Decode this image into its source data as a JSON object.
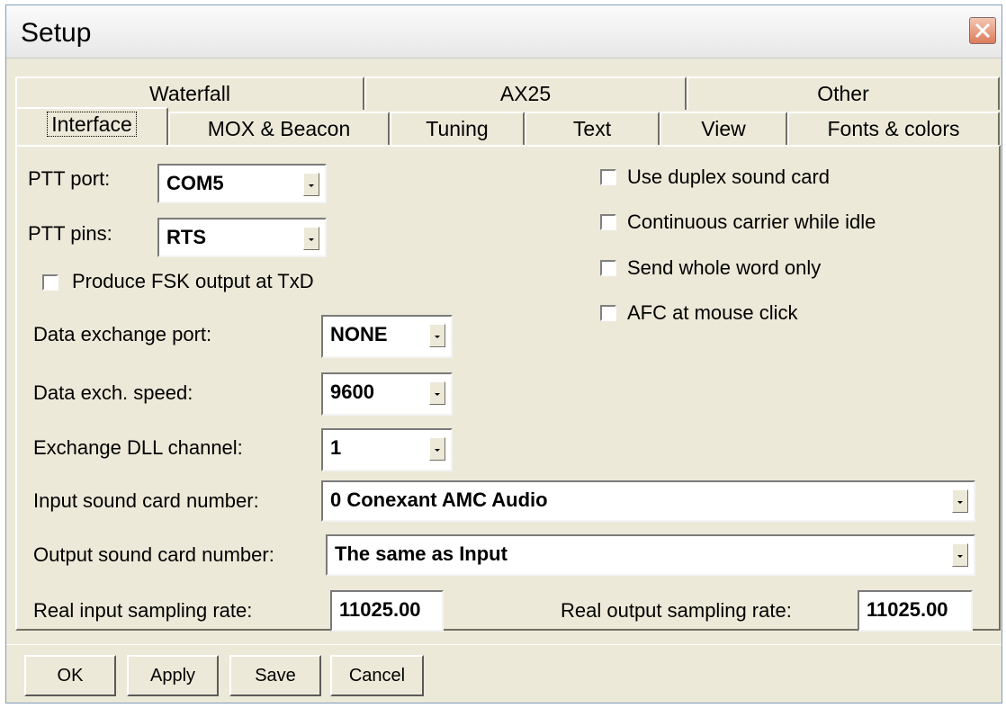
{
  "window": {
    "title": "Setup"
  },
  "tabs_row1": [
    {
      "label": "Waterfall"
    },
    {
      "label": "AX25"
    },
    {
      "label": "Other"
    }
  ],
  "tabs_row2": [
    {
      "label": "Interface",
      "selected": true
    },
    {
      "label": "MOX & Beacon"
    },
    {
      "label": "Tuning"
    },
    {
      "label": "Text"
    },
    {
      "label": "View"
    },
    {
      "label": "Fonts & colors"
    }
  ],
  "ptt_port": {
    "label": "PTT port:",
    "value": "COM5"
  },
  "ptt_pins": {
    "label": "PTT pins:",
    "value": "RTS"
  },
  "fsk": {
    "label": "Produce FSK output at TxD",
    "checked": false
  },
  "checkboxes": [
    {
      "label": "Use duplex sound card",
      "checked": false
    },
    {
      "label": "Continuous carrier while idle",
      "checked": false
    },
    {
      "label": "Send whole word only",
      "checked": false
    },
    {
      "label": "AFC at mouse click",
      "checked": false
    }
  ],
  "data_exchange_port": {
    "label": "Data exchange port:",
    "value": "NONE"
  },
  "data_exch_speed": {
    "label": "Data exch. speed:",
    "value": "9600"
  },
  "exchange_dll_channel": {
    "label": "Exchange DLL channel:",
    "value": "1"
  },
  "input_sound_card": {
    "label": "Input sound card number:",
    "value": "0  Conexant AMC Audio"
  },
  "output_sound_card": {
    "label": "Output sound card number:",
    "value": "The same as Input"
  },
  "input_rate": {
    "label": "Real input sampling rate:",
    "value": "11025.00"
  },
  "output_rate": {
    "label": "Real output sampling rate:",
    "value": "11025.00"
  },
  "buttons": {
    "ok": "OK",
    "apply": "Apply",
    "save": "Save",
    "cancel": "Cancel"
  },
  "icons": {
    "close": "close-icon"
  }
}
